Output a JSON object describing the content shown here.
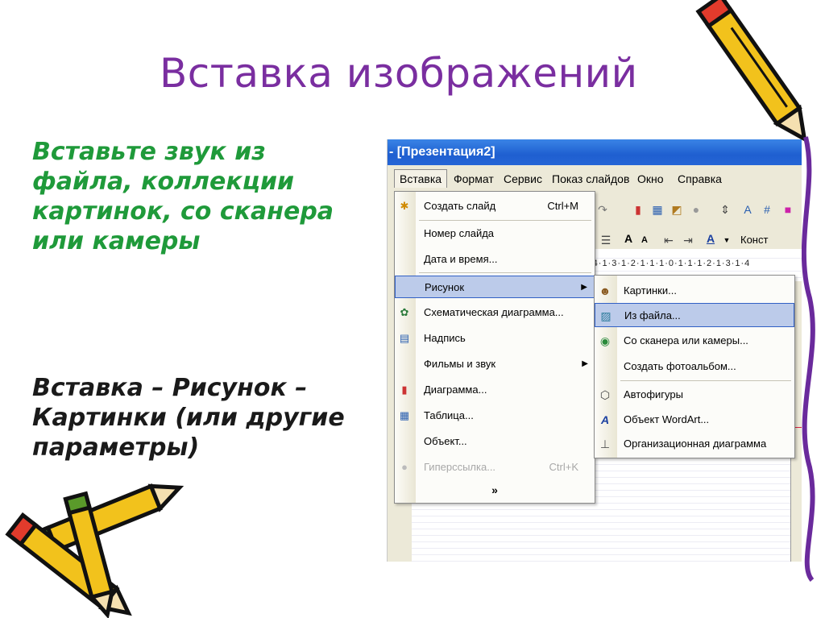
{
  "slide": {
    "title": "Вставка изображений",
    "paragraph_1": "Вставьте звук из файла, коллекции картинок, со сканера или камеры",
    "paragraph_2": "Вставка – Рисунок – Картинки (или другие параметры)"
  },
  "app": {
    "window_title": "- [Презентация2]",
    "menu": [
      "Вставка",
      "Формат",
      "Сервис",
      "Показ слайдов",
      "Окно",
      "Справка"
    ],
    "toolbar_button_label": "Конст",
    "ruler": "·4·1·3·1·2·1·1·1·0·1·1·1·2·1·3·1·4"
  },
  "insert_menu": [
    {
      "label": "Создать слайд",
      "shortcut": "Ctrl+M",
      "icon": "new-slide-icon"
    },
    {
      "label": "Номер слайда"
    },
    {
      "label": "Дата и время..."
    },
    {
      "label": "Рисунок",
      "submenu": true
    },
    {
      "label": "Схематическая диаграмма...",
      "icon": "diagram-icon"
    },
    {
      "label": "Надпись",
      "icon": "text-box-icon"
    },
    {
      "label": "Фильмы и звук",
      "submenu": true
    },
    {
      "label": "Диаграмма...",
      "icon": "chart-icon"
    },
    {
      "label": "Таблица...",
      "icon": "table-icon"
    },
    {
      "label": "Объект..."
    },
    {
      "label": "Гиперссылка...",
      "shortcut": "Ctrl+K",
      "icon": "hyperlink-icon",
      "disabled": true
    }
  ],
  "expand_glyph": "»",
  "picture_submenu": [
    {
      "label": "Картинки...",
      "icon": "clipart-icon"
    },
    {
      "label": "Из файла...",
      "icon": "from-file-icon"
    },
    {
      "label": "Со сканера или камеры...",
      "icon": "scanner-icon"
    },
    {
      "label": "Создать фотоальбом..."
    },
    {
      "label": "Автофигуры",
      "icon": "autoshapes-icon"
    },
    {
      "label": "Объект WordArt...",
      "icon": "wordart-icon"
    },
    {
      "label": "Организационная диаграмма",
      "icon": "org-chart-icon"
    }
  ],
  "colors": {
    "title": "#7a2ea0",
    "green_text": "#1f9a3a",
    "menu_highlight": "#bccbea",
    "titlebar": "#1f5fd0"
  }
}
